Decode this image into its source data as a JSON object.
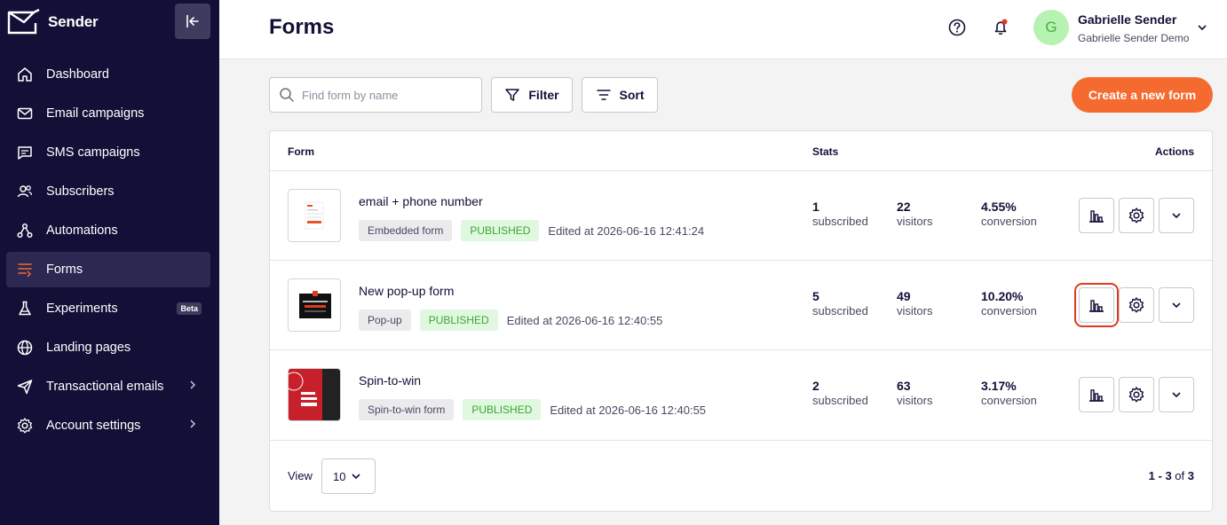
{
  "brand": {
    "name": "Sender"
  },
  "sidebar": {
    "items": [
      {
        "label": "Dashboard",
        "icon": "home-icon"
      },
      {
        "label": "Email campaigns",
        "icon": "mail-icon"
      },
      {
        "label": "SMS campaigns",
        "icon": "message-icon"
      },
      {
        "label": "Subscribers",
        "icon": "users-icon"
      },
      {
        "label": "Automations",
        "icon": "automation-icon"
      },
      {
        "label": "Forms",
        "icon": "forms-icon",
        "active": true
      },
      {
        "label": "Experiments",
        "icon": "flask-icon",
        "badge": "Beta"
      },
      {
        "label": "Landing pages",
        "icon": "globe-icon"
      },
      {
        "label": "Transactional emails",
        "icon": "send-icon"
      },
      {
        "label": "Account settings",
        "icon": "gear-icon"
      }
    ]
  },
  "header": {
    "title": "Forms",
    "user": {
      "initial": "G",
      "name": "Gabrielle Sender",
      "org": "Gabrielle Sender Demo"
    }
  },
  "toolbar": {
    "search_placeholder": "Find form by name",
    "filter_label": "Filter",
    "sort_label": "Sort",
    "create_label": "Create a new form"
  },
  "table": {
    "headers": {
      "form": "Form",
      "stats": "Stats",
      "actions": "Actions"
    },
    "rows": [
      {
        "name": "email + phone number",
        "type": "Embedded form",
        "status": "PUBLISHED",
        "edited": "Edited at 2026-06-16 12:41:24",
        "subscribed": "1",
        "visitors": "22",
        "conversion": "4.55%"
      },
      {
        "name": "New pop-up form",
        "type": "Pop-up",
        "status": "PUBLISHED",
        "edited": "Edited at 2026-06-16 12:40:55",
        "subscribed": "5",
        "visitors": "49",
        "conversion": "10.20%"
      },
      {
        "name": "Spin-to-win",
        "type": "Spin-to-win form",
        "status": "PUBLISHED",
        "edited": "Edited at 2026-06-16 12:40:55",
        "subscribed": "2",
        "visitors": "63",
        "conversion": "3.17%"
      }
    ],
    "stat_labels": {
      "subscribed": "subscribed",
      "visitors": "visitors",
      "conversion": "conversion"
    }
  },
  "footer": {
    "view_label": "View",
    "view_value": "10",
    "range": "1 - 3",
    "of": "of",
    "total": "3"
  },
  "colors": {
    "sidebar": "#121037",
    "accent": "#f56a2e",
    "published": "#3ba532",
    "highlight": "#e23a1e"
  }
}
